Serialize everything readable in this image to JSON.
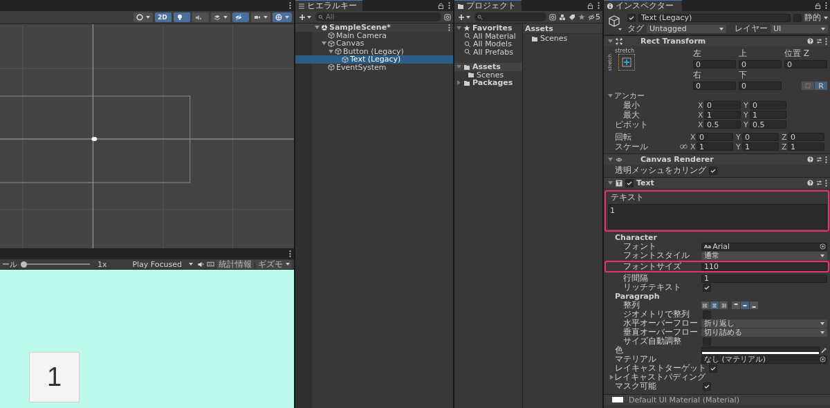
{
  "scene": {
    "toolbar": [
      {
        "kind": "shading",
        "on": false
      },
      {
        "kind": "mode",
        "label": "2D",
        "on": true
      },
      {
        "kind": "lighting",
        "on": true
      },
      {
        "kind": "audio",
        "on": false
      },
      {
        "kind": "effects",
        "on": false
      },
      {
        "kind": "visibility",
        "on": true
      },
      {
        "kind": "camera",
        "on": false
      },
      {
        "kind": "gizmos",
        "on": true
      }
    ]
  },
  "game": {
    "scale_label": "ール",
    "scale": {
      "level": 0
    },
    "scale_value": "1x",
    "play_mode": "Play Focused",
    "stats": "統計情報",
    "gizmos": "ギズモ",
    "preview_text": "1"
  },
  "hierarchy": {
    "tab": "ヒエラルキー",
    "search_placeholder": "All",
    "tree": [
      {
        "kind": "scene",
        "label": "SampleScene*",
        "expanded": true,
        "selected": false,
        "children": [
          {
            "kind": "object",
            "label": "Main Camera",
            "selected": false
          },
          {
            "kind": "object",
            "label": "Canvas",
            "expanded": true,
            "selected": false,
            "children": [
              {
                "kind": "object",
                "label": "Button (Legacy)",
                "expanded": true,
                "selected": false,
                "children": [
                  {
                    "kind": "object",
                    "label": "Text (Legacy)",
                    "selected": true
                  }
                ]
              }
            ]
          },
          {
            "kind": "object",
            "label": "EventSystem",
            "selected": false
          }
        ]
      }
    ]
  },
  "project": {
    "tab": "プロジェクト",
    "hidden_count": "5",
    "favorites": {
      "label": "Favorites",
      "expanded": true,
      "items": [
        {
          "label": "All Material",
          "selected": false
        },
        {
          "label": "All Models",
          "selected": false
        },
        {
          "label": "All Prefabs",
          "selected": false
        }
      ]
    },
    "folders": [
      {
        "label": "Assets",
        "expanded": true,
        "selected": true,
        "children": [
          {
            "label": "Scenes",
            "selected": false
          }
        ]
      },
      {
        "label": "Packages",
        "expanded": false,
        "selected": false
      }
    ],
    "breadcrumb": "Assets",
    "contents": [
      "Scenes"
    ]
  },
  "inspector": {
    "tab": "インスペクター",
    "object": {
      "active": true,
      "name": "Text (Legacy)",
      "static": false,
      "static_label": "静的",
      "tag_label": "タグ",
      "tag": "Untagged",
      "layer_label": "レイヤー",
      "layer": "UI"
    },
    "components": [
      {
        "kind": "rect-transform",
        "title": "Rect Transform",
        "expanded": true,
        "anchor_preset": {
          "horizontal": "stretch",
          "vertical": "stretch"
        },
        "offsets_top": [
          {
            "label": "左",
            "value": "0"
          },
          {
            "label": "上",
            "value": "0"
          },
          {
            "label": "位置 Z",
            "value": "0"
          }
        ],
        "offsets_bottom": [
          {
            "label": "右",
            "value": "0"
          },
          {
            "label": "下",
            "value": "0"
          }
        ],
        "modes": [
          {
            "kind": "blueprint",
            "selected": false
          },
          {
            "kind": "raw",
            "label": "R",
            "selected": true
          }
        ],
        "anchors": {
          "label": "アンカー",
          "expanded": true,
          "rows": [
            {
              "label": "最小",
              "fields": [
                {
                  "axis": "X",
                  "value": "0"
                },
                {
                  "axis": "Y",
                  "value": "0"
                }
              ]
            },
            {
              "label": "最大",
              "fields": [
                {
                  "axis": "X",
                  "value": "1"
                },
                {
                  "axis": "Y",
                  "value": "1"
                }
              ]
            }
          ]
        },
        "rows": [
          {
            "kind": "vector",
            "label": "ピボット",
            "fields": [
              {
                "axis": "X",
                "value": "0.5"
              },
              {
                "axis": "Y",
                "value": "0.5"
              }
            ]
          },
          {
            "kind": "vector",
            "label": "回転",
            "fields": [
              {
                "axis": "X",
                "value": "0"
              },
              {
                "axis": "Y",
                "value": "0"
              },
              {
                "axis": "Z",
                "value": "0"
              }
            ]
          },
          {
            "kind": "scale",
            "label": "スケール",
            "fields": [
              {
                "axis": "X",
                "value": "1"
              },
              {
                "axis": "Y",
                "value": "1"
              },
              {
                "axis": "Z",
                "value": "1"
              }
            ]
          }
        ]
      },
      {
        "kind": "canvas-renderer",
        "title": "Canvas Renderer",
        "expanded": true,
        "props": [
          {
            "kind": "checkbox",
            "label": "透明メッシュをカリング",
            "checked": true
          }
        ]
      },
      {
        "kind": "text",
        "title": "Text",
        "enabled": true,
        "expanded": true,
        "props": [
          {
            "kind": "textarea",
            "label": "テキスト",
            "value": "1",
            "highlighted": true
          },
          {
            "kind": "group",
            "label": "Character",
            "props": [
              {
                "kind": "object",
                "label": "フォント",
                "icon_text": "Aa",
                "value": "Arial"
              },
              {
                "kind": "dropdown",
                "label": "フォントスタイル",
                "value": "通常"
              },
              {
                "kind": "number",
                "label": "フォントサイズ",
                "value": "110",
                "highlighted": true
              },
              {
                "kind": "number",
                "label": "行間隔",
                "value": "1"
              },
              {
                "kind": "checkbox",
                "label": "リッチテキスト",
                "checked": true
              }
            ]
          },
          {
            "kind": "group",
            "label": "Paragraph",
            "props": [
              {
                "kind": "alignment",
                "label": "整列",
                "horizontal": [
                  {
                    "selected": false
                  },
                  {
                    "selected": true
                  },
                  {
                    "selected": false
                  }
                ],
                "vertical": [
                  {
                    "selected": false
                  },
                  {
                    "selected": true
                  },
                  {
                    "selected": false
                  }
                ]
              },
              {
                "kind": "checkbox",
                "label": "ジオメトリで整列",
                "checked": false
              },
              {
                "kind": "dropdown",
                "label": "水平オーバーフロー",
                "value": "折り返し"
              },
              {
                "kind": "dropdown",
                "label": "垂直オーバーフロー",
                "value": "切り詰める"
              },
              {
                "kind": "checkbox",
                "label": "サイズ自動調整",
                "checked": false
              }
            ]
          },
          {
            "kind": "color",
            "label": "色",
            "color": "#ffffff"
          },
          {
            "kind": "object",
            "label": "マテリアル",
            "value": "なし (マテリアル)"
          },
          {
            "kind": "checkbox",
            "label": "レイキャストターゲット",
            "checked": true
          },
          {
            "kind": "foldout",
            "label": "レイキャストパディング",
            "expanded": false
          },
          {
            "kind": "checkbox",
            "label": "マスク可能",
            "checked": true
          }
        ]
      }
    ],
    "material": {
      "name": "Default UI Material (Material)"
    }
  }
}
